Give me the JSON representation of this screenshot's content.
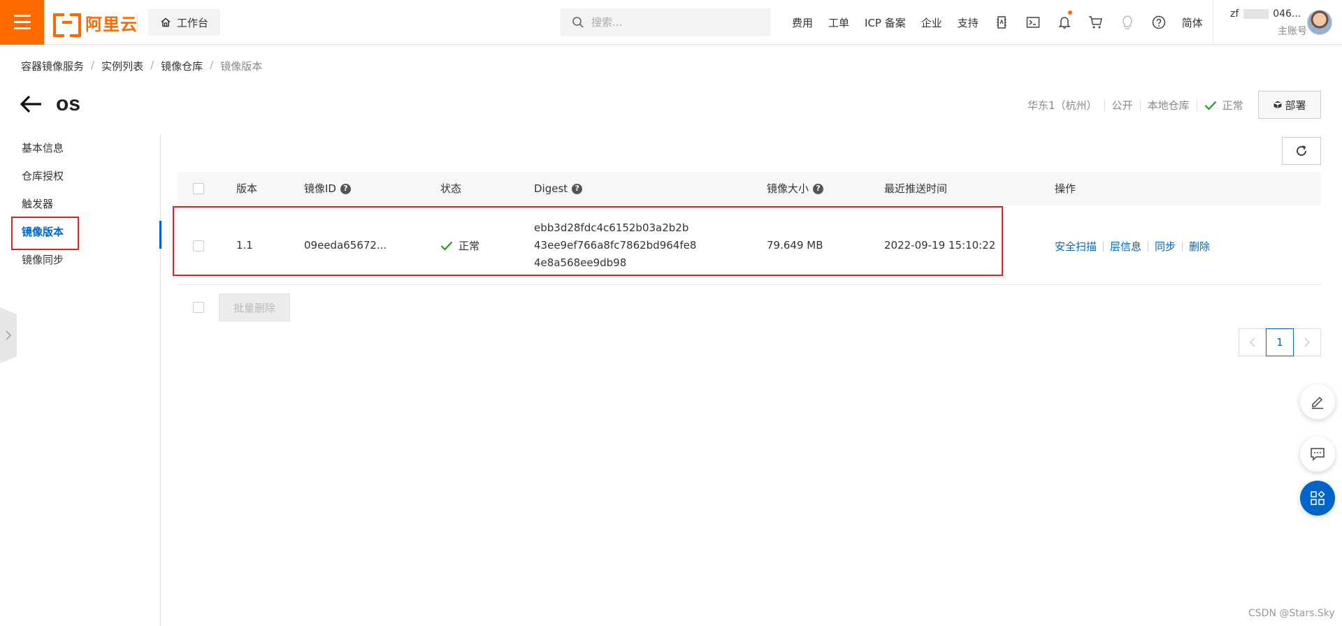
{
  "topbar": {
    "logo_text": "阿里云",
    "workbench_label": "工作台",
    "search_placeholder": "搜索...",
    "links": [
      "费用",
      "工单",
      "ICP 备案",
      "企业",
      "支持"
    ],
    "language": "简体",
    "account_prefix": "zf",
    "account_suffix": "046...",
    "account_type": "主账号",
    "accent_color": "#ff6a00"
  },
  "breadcrumb": [
    "容器镜像服务",
    "实例列表",
    "镜像仓库",
    "镜像版本"
  ],
  "page": {
    "title": "os",
    "region": "华东1（杭州）",
    "visibility": "公开",
    "repo_type": "本地仓库",
    "status": "正常",
    "deploy_label": "部署"
  },
  "sidebar": {
    "items": [
      {
        "label": "基本信息"
      },
      {
        "label": "仓库授权"
      },
      {
        "label": "触发器"
      },
      {
        "label": "镜像版本",
        "active": true
      },
      {
        "label": "镜像同步"
      }
    ]
  },
  "table": {
    "columns": {
      "version": "版本",
      "image_id": "镜像ID",
      "status": "状态",
      "digest": "Digest",
      "size": "镜像大小",
      "pushed": "最近推送时间",
      "ops": "操作"
    },
    "rows": [
      {
        "version": "1.1",
        "image_id": "09eeda65672...",
        "status": "正常",
        "digest": [
          "ebb3d28fdc4c6152b03a2b2b",
          "43ee9ef766a8fc7862bd964fe8",
          "4e8a568ee9db98"
        ],
        "size": "79.649 MB",
        "pushed": "2022-09-19 15:10:22",
        "actions": [
          "安全扫描",
          "层信息",
          "同步",
          "删除"
        ]
      }
    ]
  },
  "batch_delete_label": "批量删除",
  "pagination": {
    "current": "1"
  },
  "watermark": "CSDN @Stars.Sky",
  "colors": {
    "link": "#0064c8",
    "success": "#1ea01e",
    "highlight": "#e0232b"
  }
}
